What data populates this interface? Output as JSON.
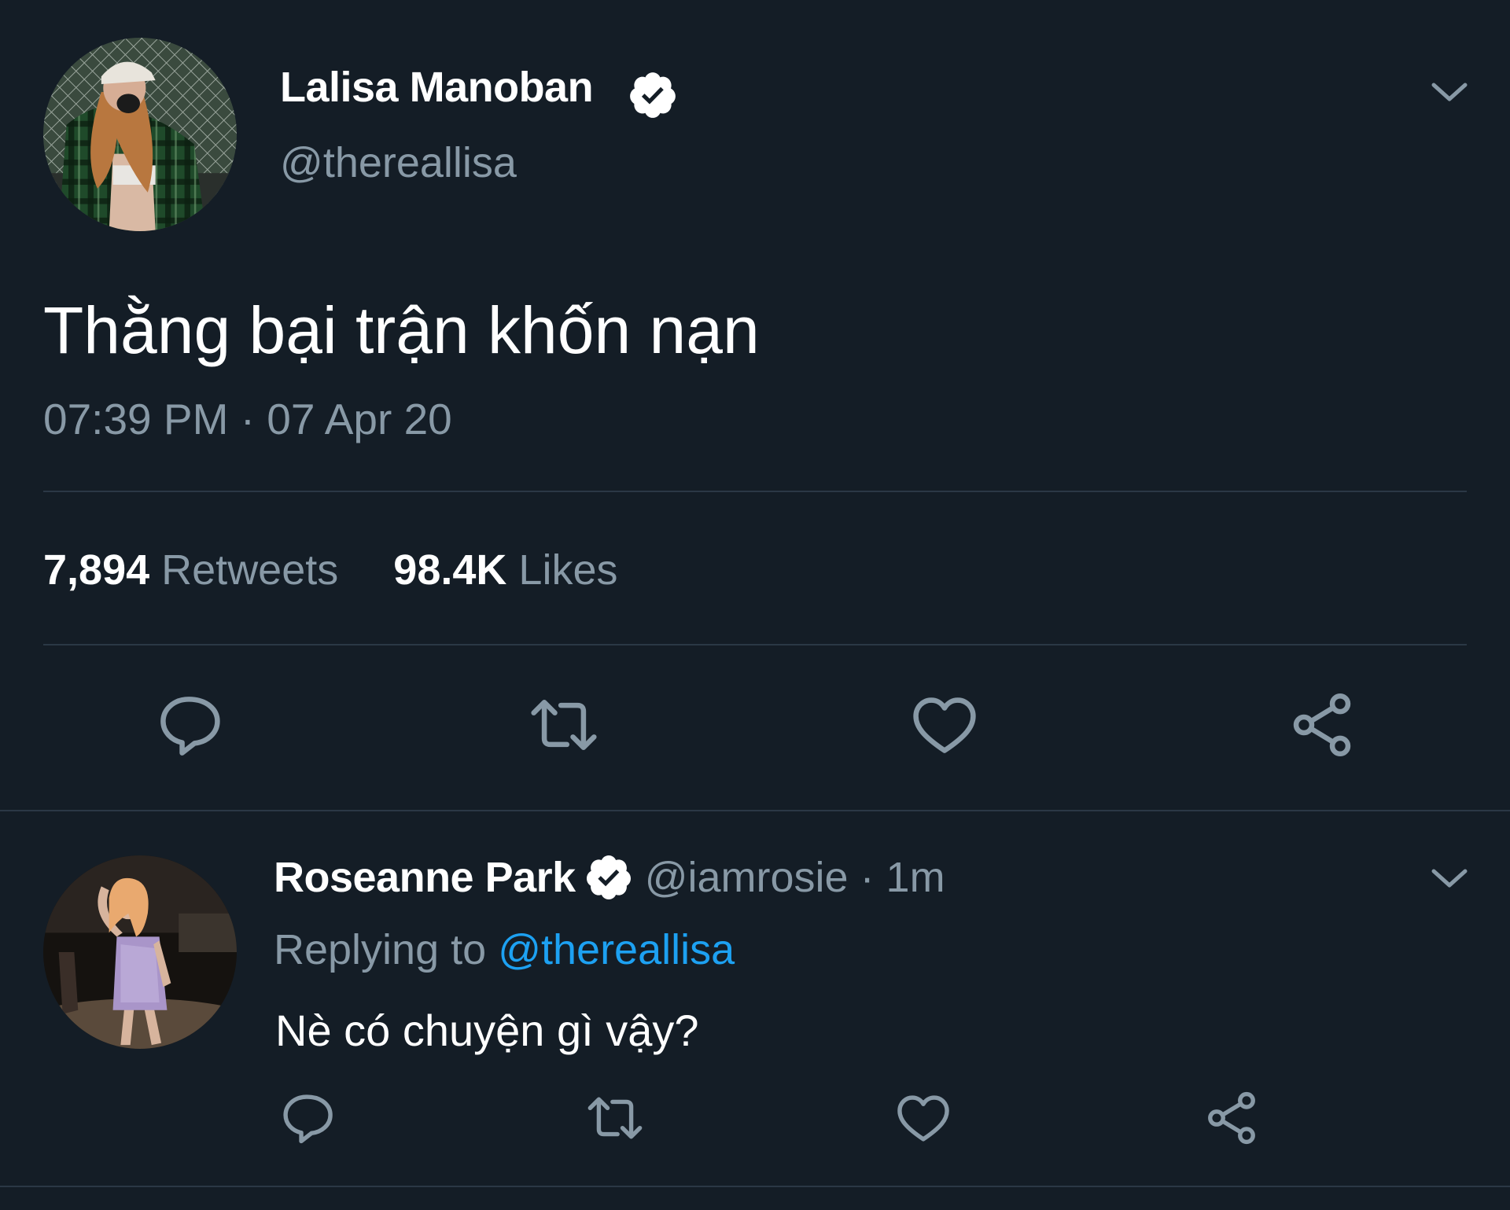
{
  "main_tweet": {
    "author_name": "Lalisa Manoban",
    "handle": "@thereallisa",
    "verified": true,
    "text": "Thằng bại trận khốn nạn",
    "timestamp": "07:39 PM · 07 Apr 20",
    "stats": {
      "retweets_count": "7,894",
      "retweets_label": "Retweets",
      "likes_count": "98.4K",
      "likes_label": "Likes"
    }
  },
  "reply_tweet": {
    "author_name": "Roseanne Park",
    "verified": true,
    "handle_time": "@iamrosie · 1m",
    "replying_label": "Replying to",
    "replying_handle": "@thereallisa",
    "text": "Nè có chuyện gì vậy?"
  },
  "icons": {
    "reply": "reply-icon",
    "retweet": "retweet-icon",
    "like": "heart-icon",
    "share": "share-icon",
    "more": "chevron-down-icon",
    "verified": "verified-badge-icon"
  },
  "colors": {
    "background": "#141d26",
    "text_primary": "#ffffff",
    "text_secondary": "#8899a6",
    "link": "#1da1f2",
    "divider": "#2b3845"
  }
}
